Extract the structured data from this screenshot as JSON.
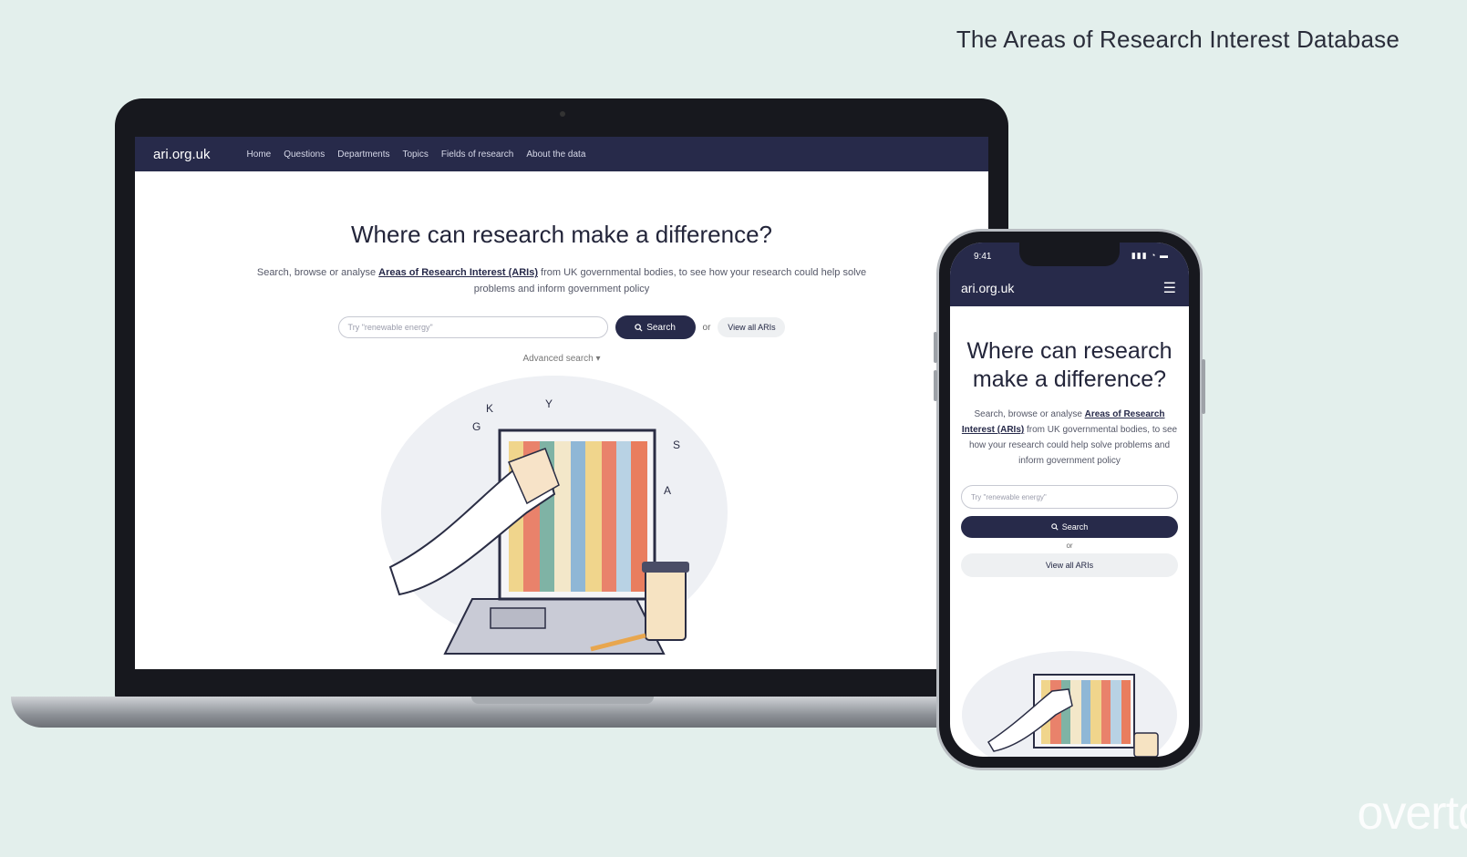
{
  "page_title": "The Areas of Research Interest Database",
  "watermark": "overto",
  "laptop": {
    "brand": "ari.org.uk",
    "nav": [
      "Home",
      "Questions",
      "Departments",
      "Topics",
      "Fields of research",
      "About the data"
    ],
    "heading": "Where can research make a difference?",
    "subtitle_before": "Search, browse or analyse ",
    "subtitle_link": "Areas of Research Interest (ARIs)",
    "subtitle_after": " from UK governmental bodies, to see how your research could help solve problems and inform government policy",
    "search_placeholder": "Try \"renewable energy\"",
    "search_button": "Search",
    "or": "or",
    "view_all": "View all ARIs",
    "advanced": "Advanced search ▾"
  },
  "phone": {
    "time": "9:41",
    "status": "▮▮▮ ◔ ▬",
    "brand": "ari.org.uk",
    "menu_icon": "☰",
    "heading": "Where can research make a difference?",
    "subtitle_before": "Search, browse or analyse ",
    "subtitle_link": "Areas of Research Interest (ARIs)",
    "subtitle_after": " from UK governmental bodies, to see how your research could help solve problems and inform government policy",
    "search_placeholder": "Try \"renewable energy\"",
    "search_button": "Search",
    "or": "or",
    "view_all": "View all ARIs"
  },
  "colors": {
    "brand_navy": "#272a4a",
    "background": "#e3efec"
  },
  "icons": {
    "search": "search-icon",
    "menu": "hamburger-menu-icon"
  }
}
